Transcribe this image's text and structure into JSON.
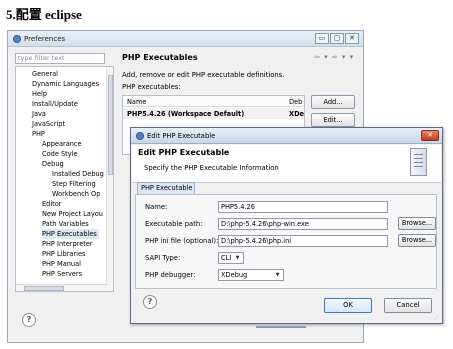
{
  "page": {
    "heading": "5.配置 eclipse"
  },
  "preferences": {
    "title": "Preferences",
    "window_buttons": [
      "▭",
      "▢",
      "✕"
    ],
    "filter_placeholder": "type filter text",
    "tree": {
      "items": [
        {
          "label": "General"
        },
        {
          "label": "Dynamic Languages"
        },
        {
          "label": "Help"
        },
        {
          "label": "Install/Update"
        },
        {
          "label": "Java"
        },
        {
          "label": "JavaScript"
        },
        {
          "label": "PHP"
        },
        {
          "label": "Appearance"
        },
        {
          "label": "Code Style"
        },
        {
          "label": "Debug"
        },
        {
          "label": "Installed Debug"
        },
        {
          "label": "Step Filtering"
        },
        {
          "label": "Workbench Op"
        },
        {
          "label": "Editor"
        },
        {
          "label": "New Project Layou"
        },
        {
          "label": "Path Variables"
        },
        {
          "label": "PHP Executables",
          "selected": true
        },
        {
          "label": "PHP Interpreter"
        },
        {
          "label": "PHP Libraries"
        },
        {
          "label": "PHP Manual"
        },
        {
          "label": "PHP Servers"
        }
      ]
    },
    "page_title": "PHP Executables",
    "nav_arrows": "⇦ ▾ ⇨ ▾ ▾",
    "description": "Add, remove or edit PHP executable definitions.",
    "executables_label": "PHP executables:",
    "table": {
      "columns": [
        "Name",
        "Deb"
      ],
      "rows": [
        {
          "name": "PHP5.4.26 (Workspace Default)",
          "debugger": "XDe"
        }
      ]
    },
    "buttons": {
      "add": "Add...",
      "edit": "Edit..."
    },
    "help_icon": "?"
  },
  "dialog": {
    "title": "Edit PHP Executable",
    "close_label": "✕",
    "heading": "Edit PHP Executable",
    "subtitle": "Specify the PHP Executable Information",
    "tab": "PHP Executable",
    "fields": {
      "name": {
        "label": "Name:",
        "value": "PHP5.4.26"
      },
      "exe_path": {
        "label": "Executable path:",
        "value": "D:\\php-5.4.26\\php-win.exe",
        "browse": "Browse..."
      },
      "ini_file": {
        "label": "PHP ini file (optional):",
        "value": "D:\\php-5.4.26\\php.ini",
        "browse": "Browse..."
      },
      "sapi": {
        "label": "SAPI Type:",
        "value": "CLI"
      },
      "debugger": {
        "label": "PHP debugger:",
        "value": "XDebug"
      }
    },
    "help_icon": "?",
    "ok": "OK",
    "cancel": "Cancel"
  }
}
